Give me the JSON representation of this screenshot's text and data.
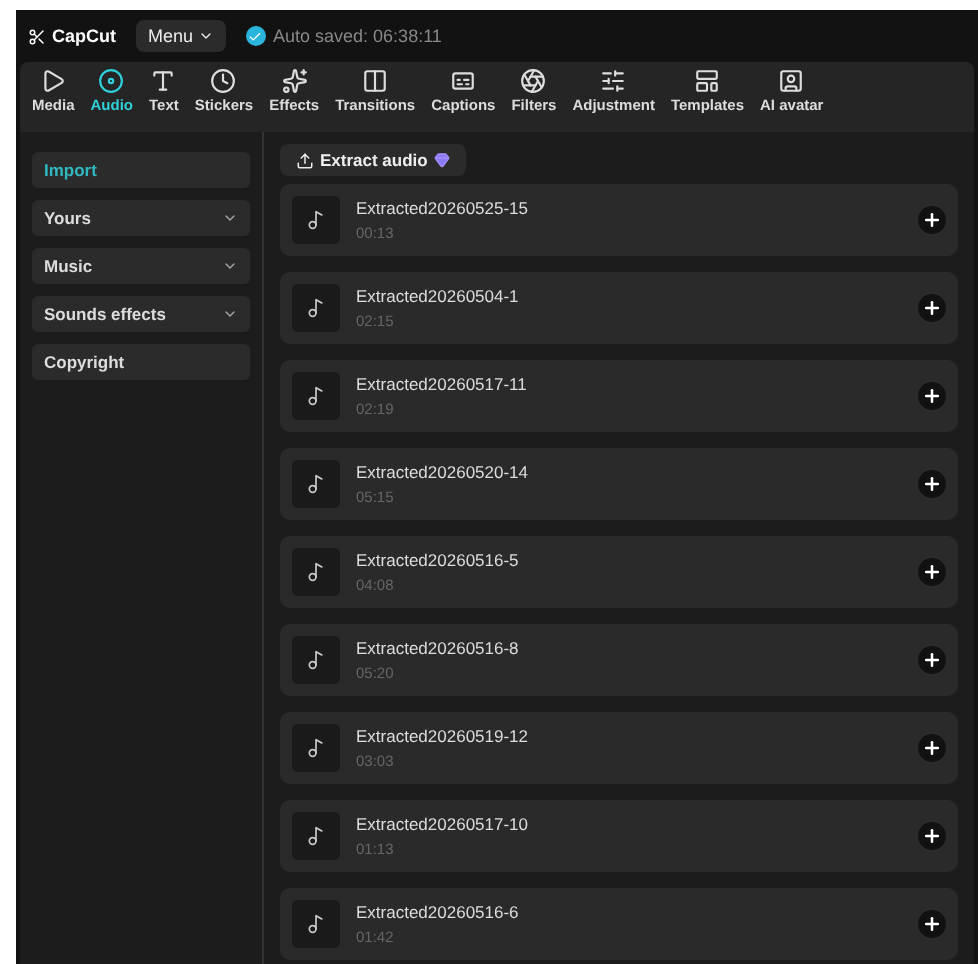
{
  "app": {
    "logo": "CapCut",
    "menu": "Menu",
    "autosave": "Auto saved: 06:38:11"
  },
  "tabs": [
    {
      "label": "Media",
      "selected": false
    },
    {
      "label": "Audio",
      "selected": true
    },
    {
      "label": "Text",
      "selected": false
    },
    {
      "label": "Stickers",
      "selected": false
    },
    {
      "label": "Effects",
      "selected": false
    },
    {
      "label": "Transitions",
      "selected": false
    },
    {
      "label": "Captions",
      "selected": false
    },
    {
      "label": "Filters",
      "selected": false
    },
    {
      "label": "Adjustment",
      "selected": false
    },
    {
      "label": "Templates",
      "selected": false
    },
    {
      "label": "AI avatar",
      "selected": false
    }
  ],
  "sidebar": {
    "items": [
      {
        "label": "Import",
        "selected": true,
        "expandable": false
      },
      {
        "label": "Yours",
        "selected": false,
        "expandable": true
      },
      {
        "label": "Music",
        "selected": false,
        "expandable": true
      },
      {
        "label": "Sounds effects",
        "selected": false,
        "expandable": true
      },
      {
        "label": "Copyright",
        "selected": false,
        "expandable": false
      }
    ]
  },
  "extract_button": "Extract audio",
  "tracks": [
    {
      "name": "Extracted20260525-15",
      "duration": "00:13"
    },
    {
      "name": "Extracted20260504-1",
      "duration": "02:15"
    },
    {
      "name": "Extracted20260517-11",
      "duration": "02:19"
    },
    {
      "name": "Extracted20260520-14",
      "duration": "05:15"
    },
    {
      "name": "Extracted20260516-5",
      "duration": "04:08"
    },
    {
      "name": "Extracted20260516-8",
      "duration": "05:20"
    },
    {
      "name": "Extracted20260519-12",
      "duration": "03:03"
    },
    {
      "name": "Extracted20260517-10",
      "duration": "01:13"
    },
    {
      "name": "Extracted20260516-6",
      "duration": "01:42"
    }
  ]
}
